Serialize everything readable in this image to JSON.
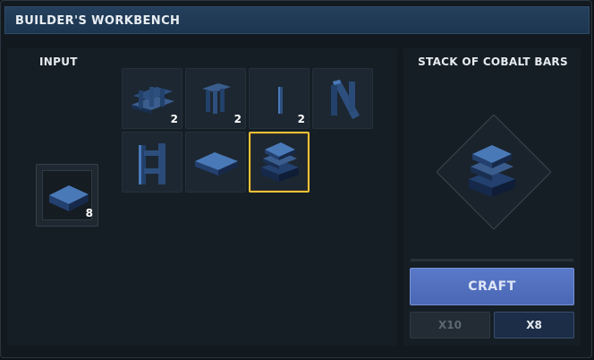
{
  "window": {
    "title": "BUILDER'S WORKBENCH"
  },
  "input": {
    "label": "INPUT",
    "item": {
      "icon": "cobalt-bar-icon",
      "count": "8"
    }
  },
  "recipes": [
    {
      "icon": "cobalt-fence-icon",
      "count": "2",
      "selected": false
    },
    {
      "icon": "cobalt-posts-icon",
      "count": "2",
      "selected": false
    },
    {
      "icon": "cobalt-rod-icon",
      "count": "2",
      "selected": false
    },
    {
      "icon": "cobalt-brace-icon",
      "count": "",
      "selected": false
    },
    {
      "icon": "cobalt-frame-icon",
      "count": "",
      "selected": false
    },
    {
      "icon": "cobalt-bar-icon",
      "count": "",
      "selected": false
    },
    {
      "icon": "stack-of-cobalt-bars-icon",
      "count": "",
      "selected": true
    }
  ],
  "result": {
    "title": "STACK OF COBALT BARS",
    "icon": "stack-of-cobalt-bars-icon"
  },
  "actions": {
    "craft_label": "CRAFT",
    "x10_label": "X10",
    "x8_label": "X8"
  },
  "colors": {
    "selection": "#f0c23a",
    "craft": "#5a79c8",
    "titlebar": "#1d3550"
  }
}
